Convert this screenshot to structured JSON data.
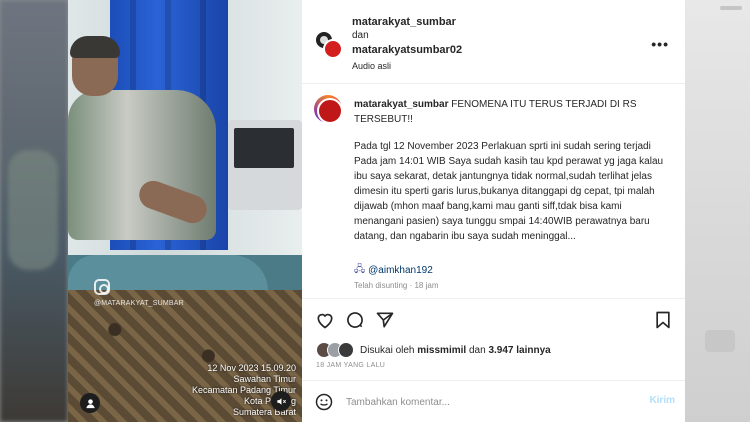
{
  "post": {
    "header": {
      "user1": "matarakyat_sumbar",
      "joiner": "dan",
      "user2": "matarakyatsumbar02",
      "audio": "Audio asli"
    },
    "caption": {
      "username": "matarakyat_sumbar",
      "headline": "FENOMENA ITU TERUS TERJADI DI RS TERSEBUT!!",
      "body": "Pada tgl 12 November 2023 Perlakuan sprti ini sudah sering terjadi Pada jam 14:01 WIB Saya sudah kasih tau kpd perawat yg jaga kalau ibu saya sekarat, detak jantungnya tidak normal,sudah terlihat jelas dimesin itu sperti garis lurus,bukanya ditanggapi dg cepat, tpi malah dijawab (mhon maaf bang,kami mau ganti siff,tdak bisa kami menangani pasien) saya tunggu smpai 14:40WIB perawatnya baru datang, dan ngabarin ibu saya sudah meninggal...",
      "mention": "@aimkhan192",
      "edited": "Telah disunting · 18 jam"
    },
    "likes": {
      "prefix": "Disukai oleh",
      "liker": "missmimil",
      "joiner": "dan",
      "others": "3.947 lainnya"
    },
    "time_ago": "18 JAM YANG LALU",
    "comment": {
      "placeholder": "Tambahkan komentar...",
      "post_label": "Kirim"
    }
  },
  "video": {
    "watermark": "@MATARAKYAT_SUMBAR",
    "overlay": [
      "12 Nov 2023 15.09.20",
      "Sawahan Timur",
      "Kecamatan Padang Timur",
      "Kota Padang",
      "Sumatera Barat"
    ]
  },
  "icons": {
    "more": "more-options-icon",
    "like": "heart-icon",
    "comment": "comment-icon",
    "share": "share-icon",
    "save": "bookmark-icon",
    "emoji": "emoji-icon",
    "mute": "mute-icon",
    "tagged": "user-tag-icon"
  }
}
